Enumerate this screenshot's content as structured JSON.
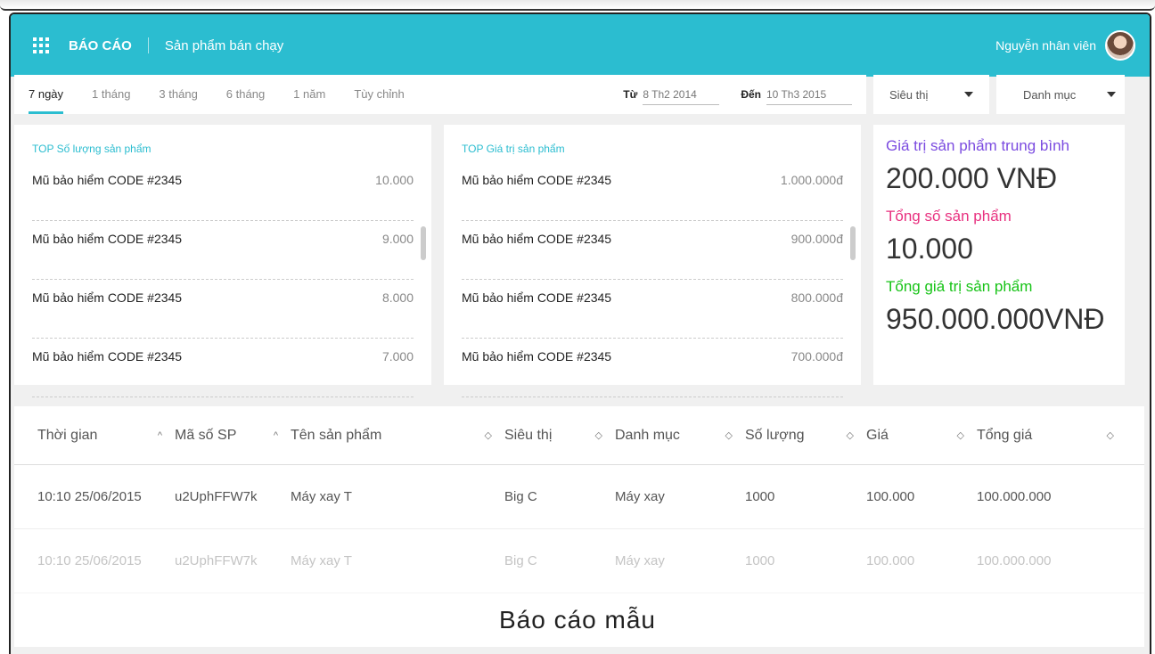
{
  "header": {
    "app_title": "BÁO CÁO",
    "breadcrumb": "Sản phẩm bán chạy",
    "user_name": "Nguyễn nhân viên",
    "accent_color": "#2bbdd0",
    "menu_icon": "grid-icon"
  },
  "filters": {
    "tabs": [
      "7 ngày",
      "1 tháng",
      "3 tháng",
      "6 tháng",
      "1 năm",
      "Tùy chỉnh"
    ],
    "active_tab": "7 ngày",
    "from_label": "Từ",
    "from_value": "8 Th2 2014",
    "to_label": "Đến",
    "to_value": "10 Th3 2015",
    "store_select": "Siêu thị",
    "category_select": "Danh mục"
  },
  "top_quantity": {
    "title": "TOP Số lượng sản phẩm",
    "items": [
      {
        "name": "Mũ bảo hiểm CODE #2345",
        "value": "10.000"
      },
      {
        "name": "Mũ bảo hiểm CODE #2345",
        "value": "9.000"
      },
      {
        "name": "Mũ bảo hiểm CODE #2345",
        "value": "8.000"
      },
      {
        "name": "Mũ bảo hiểm CODE #2345",
        "value": "7.000"
      }
    ]
  },
  "top_value": {
    "title": "TOP Giá trị sản phẩm",
    "items": [
      {
        "name": "Mũ bảo hiểm CODE #2345",
        "value": "1.000.000đ"
      },
      {
        "name": "Mũ bảo hiểm CODE #2345",
        "value": "900.000đ"
      },
      {
        "name": "Mũ bảo hiểm CODE #2345",
        "value": "800.000đ"
      },
      {
        "name": "Mũ bảo hiểm CODE #2345",
        "value": "700.000đ"
      }
    ]
  },
  "stats": {
    "avg_label": "Giá trị sản phẩm trung bình",
    "avg_value": "200.000 VNĐ",
    "count_label": "Tổng số sản phẩm",
    "count_value": "10.000",
    "total_label": "Tổng giá trị sản phẩm",
    "total_value": "950.000.000VNĐ",
    "colors": {
      "avg": "#7b4be0",
      "count": "#e8307f",
      "total": "#16c316"
    }
  },
  "table": {
    "columns": [
      "Thời gian",
      "Mã số SP",
      "Tên sản phẩm",
      "Siêu thị",
      "Danh mục",
      "Số lượng",
      "Giá",
      "Tổng giá"
    ],
    "sort_icons": [
      "^",
      "^",
      "◇",
      "◇",
      "◇",
      "◇",
      "◇",
      "◇"
    ],
    "rows": [
      [
        "10:10 25/06/2015",
        "u2UphFFW7k",
        "Máy xay T",
        "Big C",
        "Máy xay",
        "1000",
        "100.000",
        "100.000.000"
      ],
      [
        "10:10 25/06/2015",
        "u2UphFFW7k",
        "Máy xay T",
        "Big C",
        "Máy xay",
        "1000",
        "100.000",
        "100.000.000"
      ]
    ]
  },
  "caption": "Báo cáo mẫu"
}
